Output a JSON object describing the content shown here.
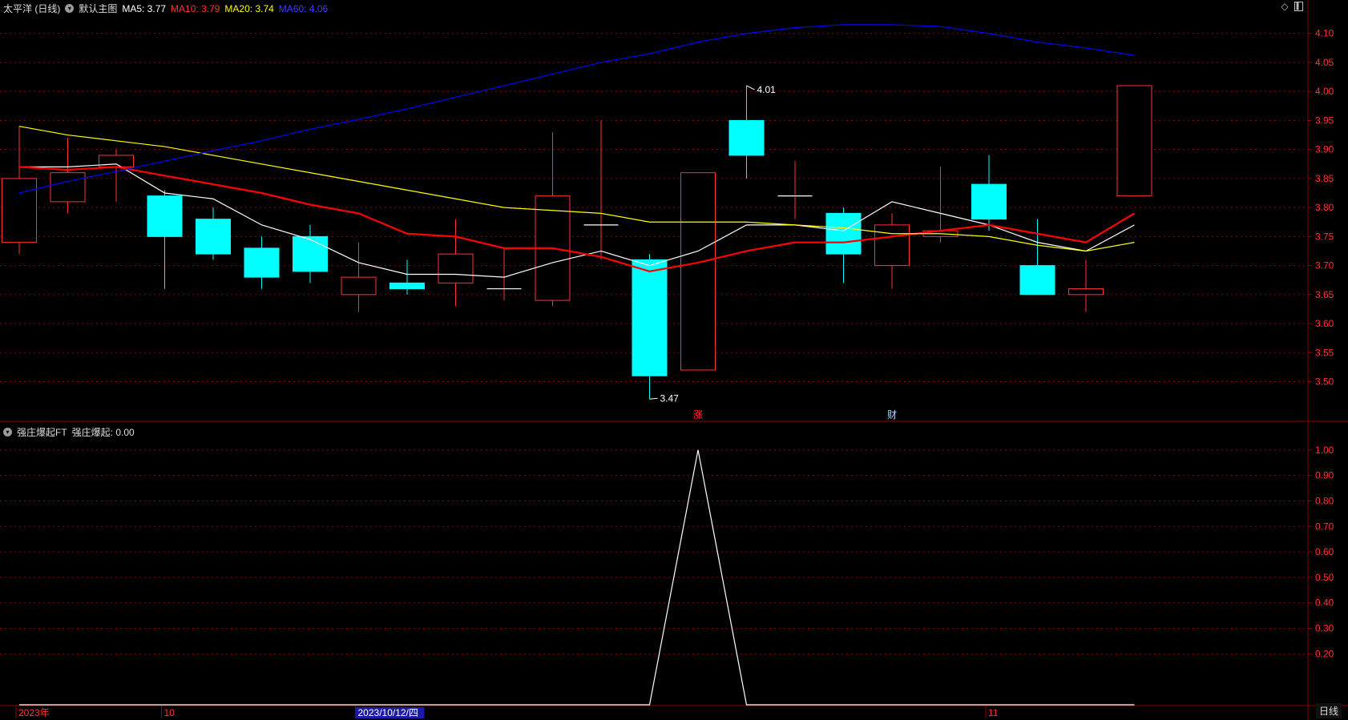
{
  "header_main": {
    "stock": "太平洋 (日线)",
    "template": "默认主图",
    "ma5": "MA5: 3.77",
    "ma10": "MA10: 3.79",
    "ma20": "MA20: 3.74",
    "ma60": "MA60: 4.06"
  },
  "header_sub": {
    "name": "强庄爆起FT",
    "value": "强庄爆起: 0.00"
  },
  "period_label": "日线",
  "colors": {
    "up": "#ff3232",
    "down": "#00ffff",
    "ma5": "#ffffff",
    "ma10": "#ff0000",
    "ma20": "#ffff00",
    "ma60": "#0000ff",
    "grid": "#8b0000",
    "axis_text": "#ff3232"
  },
  "price_axis": {
    "ticks": [
      "4.10",
      "4.05",
      "4.00",
      "3.95",
      "3.90",
      "3.85",
      "3.80",
      "3.75",
      "3.70",
      "3.65",
      "3.60",
      "3.55",
      "3.50"
    ]
  },
  "sub_axis": {
    "ticks": [
      "1.00",
      "0.90",
      "0.80",
      "0.70",
      "0.60",
      "0.50",
      "0.40",
      "0.30",
      "0.20"
    ]
  },
  "x_axis": {
    "labels": [
      {
        "i": 0,
        "text": "2023年"
      },
      {
        "i": 3,
        "text": "10"
      },
      {
        "i": 7,
        "text": "2023/10/12/四",
        "highlight": true
      },
      {
        "i": 20,
        "text": "11"
      }
    ]
  },
  "markers": [
    {
      "i": 14,
      "text": "涨",
      "color": "#ff3232"
    },
    {
      "i": 18,
      "text": "财",
      "color": "#aaddff"
    }
  ],
  "annotations": [
    {
      "i": 15,
      "price": 4.01,
      "text": "4.01",
      "where": "high"
    },
    {
      "i": 13,
      "price": 3.47,
      "text": "3.47",
      "where": "low"
    }
  ],
  "chart_data": {
    "type": "candlestick",
    "candles": [
      {
        "open": 3.74,
        "high": 3.94,
        "low": 3.72,
        "close": 3.85
      },
      {
        "open": 3.81,
        "high": 3.92,
        "low": 3.79,
        "close": 3.86
      },
      {
        "open": 3.87,
        "high": 3.9,
        "low": 3.81,
        "close": 3.89
      },
      {
        "open": 3.82,
        "high": 3.83,
        "low": 3.66,
        "close": 3.75
      },
      {
        "open": 3.78,
        "high": 3.8,
        "low": 3.71,
        "close": 3.72
      },
      {
        "open": 3.73,
        "high": 3.75,
        "low": 3.66,
        "close": 3.68
      },
      {
        "open": 3.75,
        "high": 3.77,
        "low": 3.67,
        "close": 3.69
      },
      {
        "open": 3.65,
        "high": 3.74,
        "low": 3.62,
        "close": 3.68
      },
      {
        "open": 3.67,
        "high": 3.71,
        "low": 3.65,
        "close": 3.66
      },
      {
        "open": 3.67,
        "high": 3.78,
        "low": 3.63,
        "close": 3.72
      },
      {
        "open": 3.66,
        "high": 3.73,
        "low": 3.64,
        "close": 3.66
      },
      {
        "open": 3.64,
        "high": 3.93,
        "low": 3.63,
        "close": 3.82
      },
      {
        "open": 3.77,
        "high": 3.95,
        "low": 3.71,
        "close": 3.77
      },
      {
        "open": 3.71,
        "high": 3.72,
        "low": 3.47,
        "close": 3.51
      },
      {
        "open": 3.52,
        "high": 3.86,
        "low": 3.52,
        "close": 3.86
      },
      {
        "open": 3.95,
        "high": 4.01,
        "low": 3.85,
        "close": 3.89
      },
      {
        "open": 3.82,
        "high": 3.88,
        "low": 3.78,
        "close": 3.82
      },
      {
        "open": 3.79,
        "high": 3.8,
        "low": 3.67,
        "close": 3.72
      },
      {
        "open": 3.7,
        "high": 3.79,
        "low": 3.66,
        "close": 3.77
      },
      {
        "open": 3.75,
        "high": 3.87,
        "low": 3.74,
        "close": 3.76
      },
      {
        "open": 3.84,
        "high": 3.89,
        "low": 3.76,
        "close": 3.78
      },
      {
        "open": 3.7,
        "high": 3.78,
        "low": 3.65,
        "close": 3.65
      },
      {
        "open": 3.65,
        "high": 3.71,
        "low": 3.62,
        "close": 3.66
      },
      {
        "open": 3.82,
        "high": 4.01,
        "low": 3.82,
        "close": 4.01
      }
    ],
    "ma": [
      {
        "name": "MA5",
        "color": "#ffffff",
        "width": 1.2,
        "values": [
          3.87,
          3.87,
          3.875,
          3.825,
          3.815,
          3.77,
          3.745,
          3.705,
          3.685,
          3.685,
          3.68,
          3.705,
          3.725,
          3.7,
          3.725,
          3.77,
          3.77,
          3.76,
          3.81,
          3.79,
          3.77,
          3.74,
          3.725,
          3.77
        ]
      },
      {
        "name": "MA10",
        "color": "#ff0000",
        "width": 2.2,
        "values": [
          3.87,
          3.865,
          3.87,
          3.855,
          3.84,
          3.825,
          3.805,
          3.79,
          3.755,
          3.75,
          3.73,
          3.73,
          3.715,
          3.69,
          3.705,
          3.725,
          3.74,
          3.74,
          3.75,
          3.76,
          3.77,
          3.755,
          3.74,
          3.79
        ]
      },
      {
        "name": "MA20",
        "color": "#ffff00",
        "width": 1.2,
        "values": [
          3.94,
          3.925,
          3.915,
          3.905,
          3.89,
          3.875,
          3.86,
          3.845,
          3.83,
          3.815,
          3.8,
          3.795,
          3.79,
          3.775,
          3.775,
          3.775,
          3.77,
          3.765,
          3.755,
          3.755,
          3.75,
          3.735,
          3.725,
          3.74
        ]
      },
      {
        "name": "MA60",
        "color": "#0000ff",
        "width": 1.2,
        "values": [
          3.825,
          3.845,
          3.862,
          3.88,
          3.898,
          3.915,
          3.935,
          3.952,
          3.97,
          3.99,
          4.01,
          4.03,
          4.05,
          4.065,
          4.085,
          4.1,
          4.11,
          4.115,
          4.115,
          4.112,
          4.1,
          4.085,
          4.075,
          4.062
        ]
      }
    ],
    "indicator": {
      "name": "强庄爆起",
      "values": [
        0,
        0,
        0,
        0,
        0,
        0,
        0,
        0,
        0,
        0,
        0,
        0,
        0,
        0,
        1,
        0,
        0,
        0,
        0,
        0,
        0,
        0,
        0,
        0
      ]
    },
    "price_range": [
      3.44,
      4.13
    ],
    "indicator_range": [
      0,
      1.1
    ]
  }
}
